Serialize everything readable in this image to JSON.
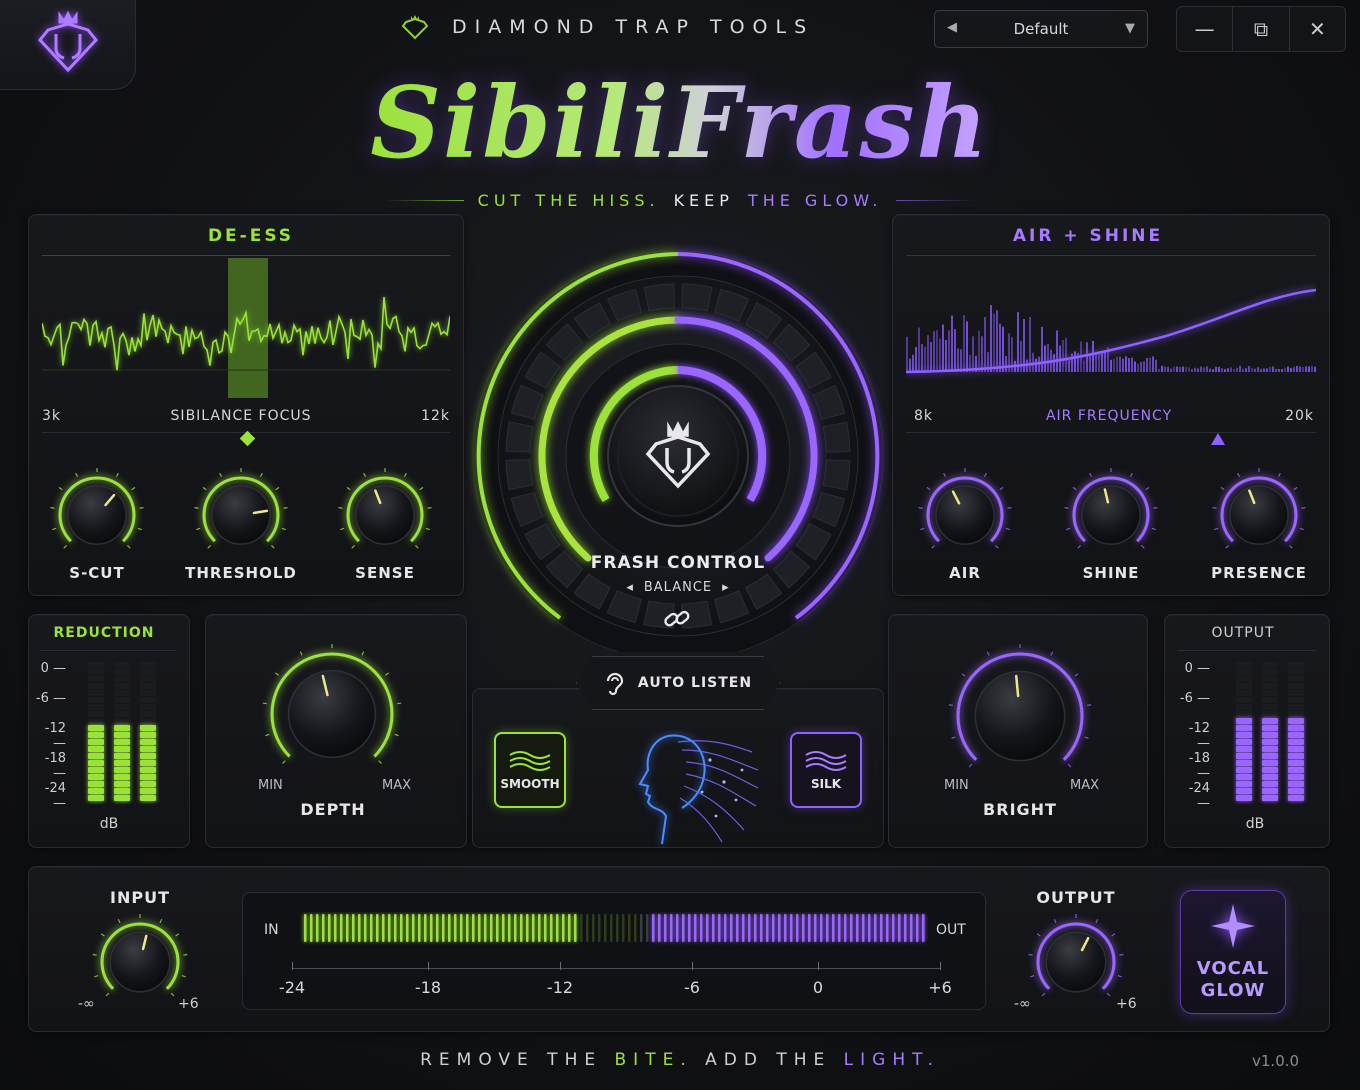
{
  "header": {
    "brand": "DIAMOND TRAP TOOLS",
    "preset": {
      "label": "Default"
    },
    "window": {
      "minimize": "—",
      "restore": "⧉",
      "close": "✕"
    }
  },
  "title": {
    "main": "SibiliFrash",
    "tag": {
      "a": "CUT THE HISS.",
      "b": "KEEP",
      "c": "THE GLOW."
    }
  },
  "deess": {
    "title": "DE-ESS",
    "min": "3k",
    "label": "SIBILANCE FOCUS",
    "max": "12k",
    "knobs": [
      {
        "label": "S-CUT",
        "value": 0.65
      },
      {
        "label": "THRESHOLD",
        "value": 0.8
      },
      {
        "label": "SENSE",
        "value": 0.42
      }
    ]
  },
  "air": {
    "title": "AIR + SHINE",
    "min": "8k",
    "label": "AIR FREQUENCY",
    "max": "20k",
    "knobs": [
      {
        "label": "AIR",
        "value": 0.4
      },
      {
        "label": "SHINE",
        "value": 0.45
      },
      {
        "label": "PRESENCE",
        "value": 0.42
      }
    ]
  },
  "center": {
    "label": "FRASH CONTROL",
    "sub": "BALANCE",
    "left_arrow": "◂",
    "right_arrow": "▸"
  },
  "reduction": {
    "title": "REDUCTION",
    "ticks": [
      "0",
      "-6",
      "-12",
      "-18",
      "-24"
    ],
    "unit": "dB",
    "level": 0.55
  },
  "output_meter": {
    "title": "OUTPUT",
    "ticks": [
      "0",
      "-6",
      "-12",
      "-18",
      "-24"
    ],
    "unit": "dB",
    "level": 0.6
  },
  "depth": {
    "label": "DEPTH",
    "min": "MIN",
    "max": "MAX",
    "value": 0.45
  },
  "bright": {
    "label": "BRIGHT",
    "min": "MIN",
    "max": "MAX",
    "value": 0.48
  },
  "modes": {
    "auto_listen": "AUTO LISTEN",
    "smooth": "SMOOTH",
    "silk": "SILK"
  },
  "io": {
    "input": {
      "label": "INPUT",
      "min": "-∞",
      "max": "+6",
      "value": 0.55
    },
    "output": {
      "label": "OUTPUT",
      "min": "-∞",
      "max": "+6",
      "value": 0.6
    },
    "meter": {
      "in": "IN",
      "out": "OUT",
      "scale": [
        "-24",
        "-18",
        "-12",
        "-6",
        "0",
        "+6"
      ]
    },
    "vocal_glow": "VOCAL\nGLOW"
  },
  "footer": {
    "a": "REMOVE THE",
    "b": "BITE.",
    "c": "ADD THE",
    "d": "LIGHT.",
    "version": "v1.0.0"
  },
  "colors": {
    "green": "#9be23a",
    "purple": "#9a66ff",
    "bg": "#111215"
  }
}
